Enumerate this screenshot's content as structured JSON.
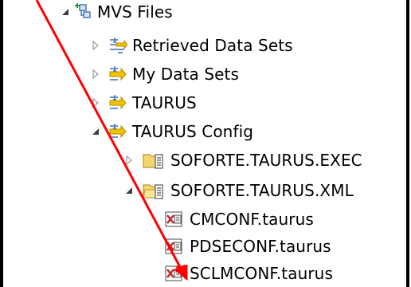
{
  "tree": {
    "root": {
      "label": "MVS Files"
    },
    "items": [
      {
        "label": "Retrieved Data Sets"
      },
      {
        "label": "My Data Sets"
      },
      {
        "label": "TAURUS"
      },
      {
        "label": "TAURUS Config"
      },
      {
        "label": "SOFORTE.TAURUS.EXEC"
      },
      {
        "label": "SOFORTE.TAURUS.XML"
      },
      {
        "label": "CMCONF.taurus"
      },
      {
        "label": "PDSECONF.taurus"
      },
      {
        "label": "SCLMCONF.taurus"
      }
    ]
  },
  "colors": {
    "annotation_arrow": "#ff0000",
    "filter_icon_yellow": "#f2c200",
    "filter_icon_blue": "#3b6fb6",
    "folder_yellow": "#f5d66b",
    "member_red": "#c0282d"
  },
  "icons": [
    "filter-icon",
    "dataset-folder-icon",
    "member-file-icon"
  ]
}
